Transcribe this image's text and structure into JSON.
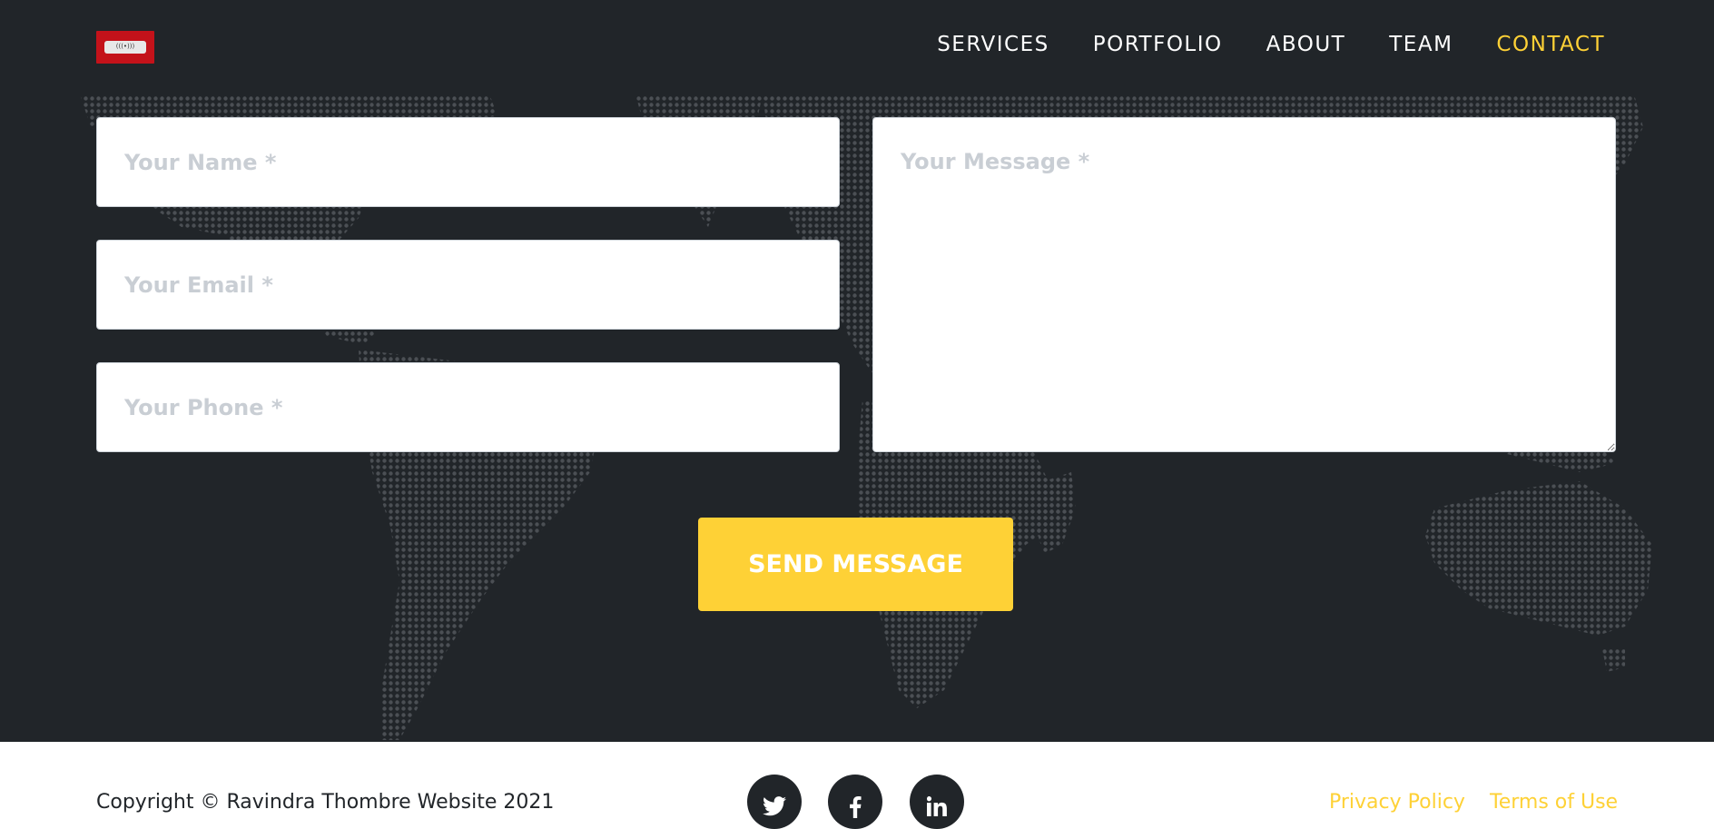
{
  "brand": {
    "logo": "mask-logo"
  },
  "nav": {
    "items": [
      {
        "label": "SERVICES"
      },
      {
        "label": "PORTFOLIO"
      },
      {
        "label": "ABOUT"
      },
      {
        "label": "TEAM"
      },
      {
        "label": "CONTACT"
      }
    ],
    "active": "CONTACT"
  },
  "form": {
    "name_placeholder": "Your Name *",
    "email_placeholder": "Your Email *",
    "phone_placeholder": "Your Phone *",
    "message_placeholder": "Your Message *",
    "submit_label": "SEND MESSAGE"
  },
  "footer": {
    "copyright": "Copyright © Ravindra Thombre Website 2021",
    "social": [
      "twitter-icon",
      "facebook-icon",
      "linkedin-icon"
    ],
    "links": [
      {
        "label": "Privacy Policy"
      },
      {
        "label": "Terms of Use"
      }
    ]
  },
  "colors": {
    "dark_bg": "#212529",
    "accent": "#fed136",
    "map_dots": "#4b4f54"
  }
}
